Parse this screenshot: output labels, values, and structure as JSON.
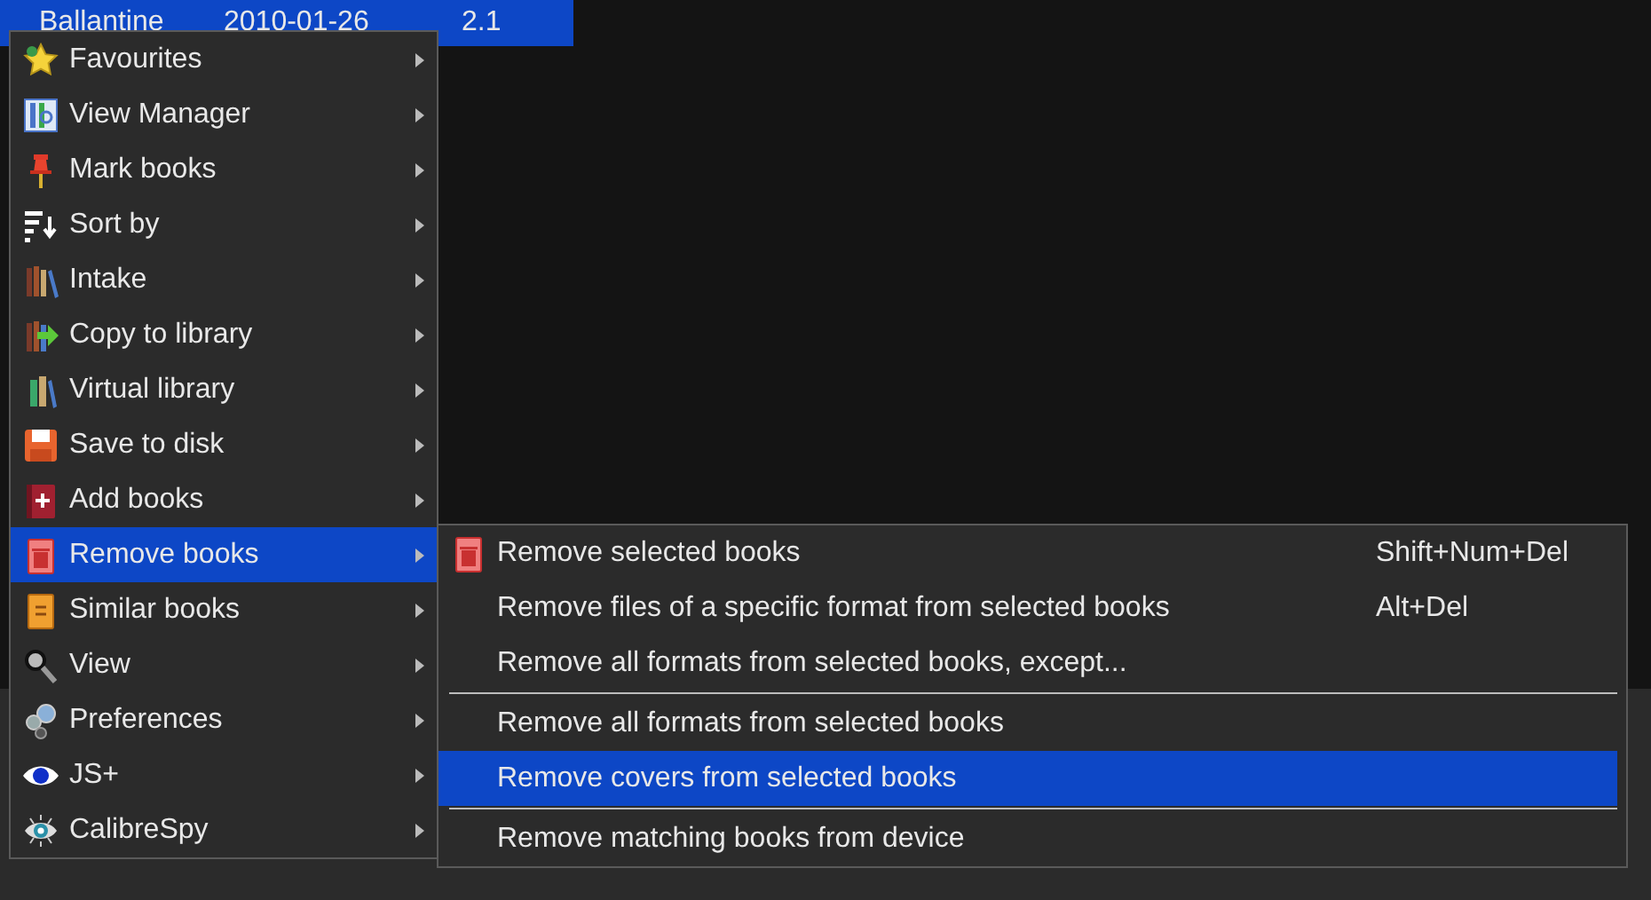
{
  "book_row": {
    "selected": true,
    "cells": [
      "Ballantine",
      "2010-01-26",
      "2.1"
    ]
  },
  "context_menu": {
    "items": [
      {
        "label": "Favourites",
        "has_submenu": true,
        "selected": false
      },
      {
        "label": "View Manager",
        "has_submenu": true,
        "selected": false
      },
      {
        "label": "Mark books",
        "has_submenu": true,
        "selected": false
      },
      {
        "label": "Sort by",
        "has_submenu": true,
        "selected": false
      },
      {
        "label": "Intake",
        "has_submenu": true,
        "selected": false
      },
      {
        "label": "Copy to library",
        "has_submenu": true,
        "selected": false
      },
      {
        "label": "Virtual library",
        "has_submenu": true,
        "selected": false
      },
      {
        "label": "Save to disk",
        "has_submenu": true,
        "selected": false
      },
      {
        "label": "Add books",
        "has_submenu": true,
        "selected": false
      },
      {
        "label": "Remove books",
        "has_submenu": true,
        "selected": true
      },
      {
        "label": "Similar books",
        "has_submenu": true,
        "selected": false
      },
      {
        "label": "View",
        "has_submenu": true,
        "selected": false
      },
      {
        "label": "Preferences",
        "has_submenu": true,
        "selected": false
      },
      {
        "label": "JS+",
        "has_submenu": true,
        "selected": false
      },
      {
        "label": "CalibreSpy",
        "has_submenu": true,
        "selected": false
      }
    ]
  },
  "submenu": {
    "items": [
      {
        "kind": "item",
        "label": "Remove selected books",
        "shortcut": "Shift+Num+Del",
        "selected": false,
        "has_icon": true
      },
      {
        "kind": "item",
        "label": "Remove files of a specific format from selected books",
        "shortcut": "Alt+Del",
        "selected": false
      },
      {
        "kind": "item",
        "label": "Remove all formats from selected books, except...",
        "selected": false
      },
      {
        "kind": "separator"
      },
      {
        "kind": "item",
        "label": "Remove all formats from selected books",
        "selected": false
      },
      {
        "kind": "item",
        "label": "Remove covers from selected books",
        "selected": true
      },
      {
        "kind": "separator"
      },
      {
        "kind": "item",
        "label": "Remove matching books from device",
        "selected": false
      }
    ]
  }
}
